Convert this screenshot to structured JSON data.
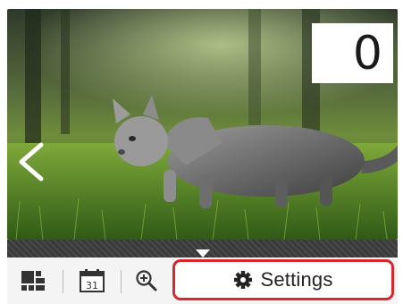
{
  "photo": {
    "subject": "kitten-on-grass"
  },
  "counter": {
    "value": "0"
  },
  "nav": {
    "prev_icon": "chevron-left-icon",
    "drawer_icon": "triangle-down-icon"
  },
  "toolbar": {
    "layout_icon": "layout-view-icon",
    "calendar_icon": "calendar-icon",
    "calendar_day": "31",
    "zoom_icon": "zoom-in-icon",
    "settings_icon": "gear-icon",
    "settings_label": "Settings"
  },
  "colors": {
    "highlight": "#d9262e",
    "toolbar_bg": "#f4f4f4",
    "strip_bg": "#3a3a3a"
  }
}
